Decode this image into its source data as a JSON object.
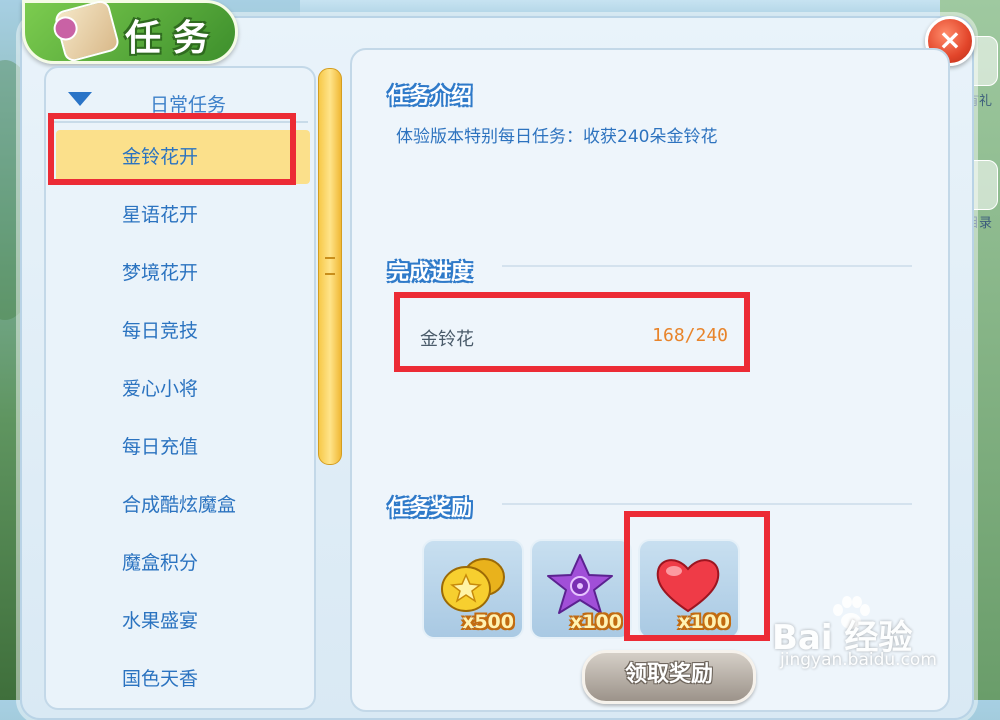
{
  "window": {
    "title": "任务",
    "close_label": "×"
  },
  "task_list": {
    "category": "日常任务",
    "items": [
      "金铃花开",
      "星语花开",
      "梦境花开",
      "每日竞技",
      "爱心小将",
      "每日充值",
      "合成酷炫魔盒",
      "魔盒积分",
      "水果盛宴",
      "国色天香"
    ],
    "selected_index": 0
  },
  "detail": {
    "intro_title": "任务介绍",
    "intro_text": "体验版本特别每日任务：收获240朵金铃花",
    "progress_title": "完成进度",
    "progress_label": "金铃花",
    "progress_value": "168/240",
    "progress_current": 168,
    "progress_total": 240,
    "reward_title": "任务奖励",
    "rewards": [
      {
        "icon": "gold-coins-icon",
        "qty": "x500"
      },
      {
        "icon": "purple-star-icon",
        "qty": "x100"
      },
      {
        "icon": "red-heart-icon",
        "qty": "x100"
      }
    ],
    "claim_button": "领取奖励"
  },
  "side_shortcuts": [
    "充值有礼",
    "魔盒目录"
  ],
  "watermark": {
    "brand": "Bai 经验",
    "url": "jingyan.baidu.com"
  },
  "colors": {
    "highlight": "#ec2b35",
    "selected_row": "#fbe08b",
    "link_blue": "#2b73c0",
    "progress_orange": "#e8842b"
  }
}
